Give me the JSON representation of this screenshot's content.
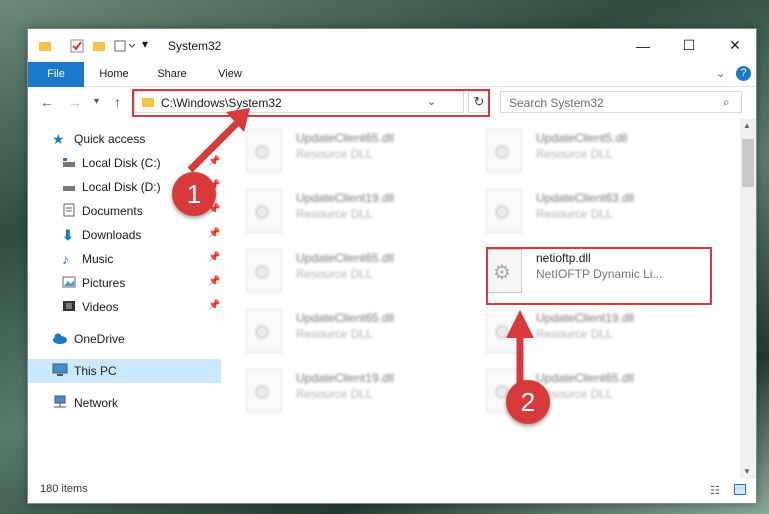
{
  "window": {
    "title": "System32"
  },
  "ribbon": {
    "tabs": [
      "File",
      "Home",
      "Share",
      "View"
    ]
  },
  "address": {
    "path": "C:\\Windows\\System32"
  },
  "search": {
    "placeholder": "Search System32"
  },
  "nav": {
    "items": [
      {
        "label": "Quick access",
        "icon": "star-icon"
      },
      {
        "label": "Local Disk (C:)",
        "icon": "drive-icon"
      },
      {
        "label": "Local Disk (D:)",
        "icon": "drive-icon"
      },
      {
        "label": "Documents",
        "icon": "document-icon"
      },
      {
        "label": "Downloads",
        "icon": "download-icon"
      },
      {
        "label": "Music",
        "icon": "music-icon"
      },
      {
        "label": "Pictures",
        "icon": "pictures-icon"
      },
      {
        "label": "Videos",
        "icon": "video-icon"
      },
      {
        "label": "OneDrive",
        "icon": "cloud-icon"
      },
      {
        "label": "This PC",
        "icon": "computer-icon"
      },
      {
        "label": "Network",
        "icon": "network-icon"
      }
    ]
  },
  "files": [
    {
      "name": "UpdateClient65.dll",
      "desc": "Resource DLL"
    },
    {
      "name": "UpdateClient5.dll",
      "desc": "Resource DLL"
    },
    {
      "name": "UpdateClient19.dll",
      "desc": "Resource DLL"
    },
    {
      "name": "UpdateClient63.dll",
      "desc": "Resource DLL"
    },
    {
      "name": "UpdateClient65.dll",
      "desc": "Resource DLL"
    },
    {
      "name": "netioftp.dll",
      "desc": "NetIOFTP Dynamic Li..."
    },
    {
      "name": "UpdateClient65.dll",
      "desc": "Resource DLL"
    },
    {
      "name": "UpdateClient19.dll",
      "desc": "Resource DLL"
    },
    {
      "name": "UpdateClient19.dll",
      "desc": "Resource DLL"
    },
    {
      "name": "UpdateClient65.dll",
      "desc": "Resource DLL"
    }
  ],
  "status": {
    "count": "180 items"
  },
  "annotations": {
    "badge1": "1",
    "badge2": "2"
  },
  "colors": {
    "accent": "#1979ca",
    "highlight": "#d9393a",
    "selected": "#cce8ff"
  }
}
